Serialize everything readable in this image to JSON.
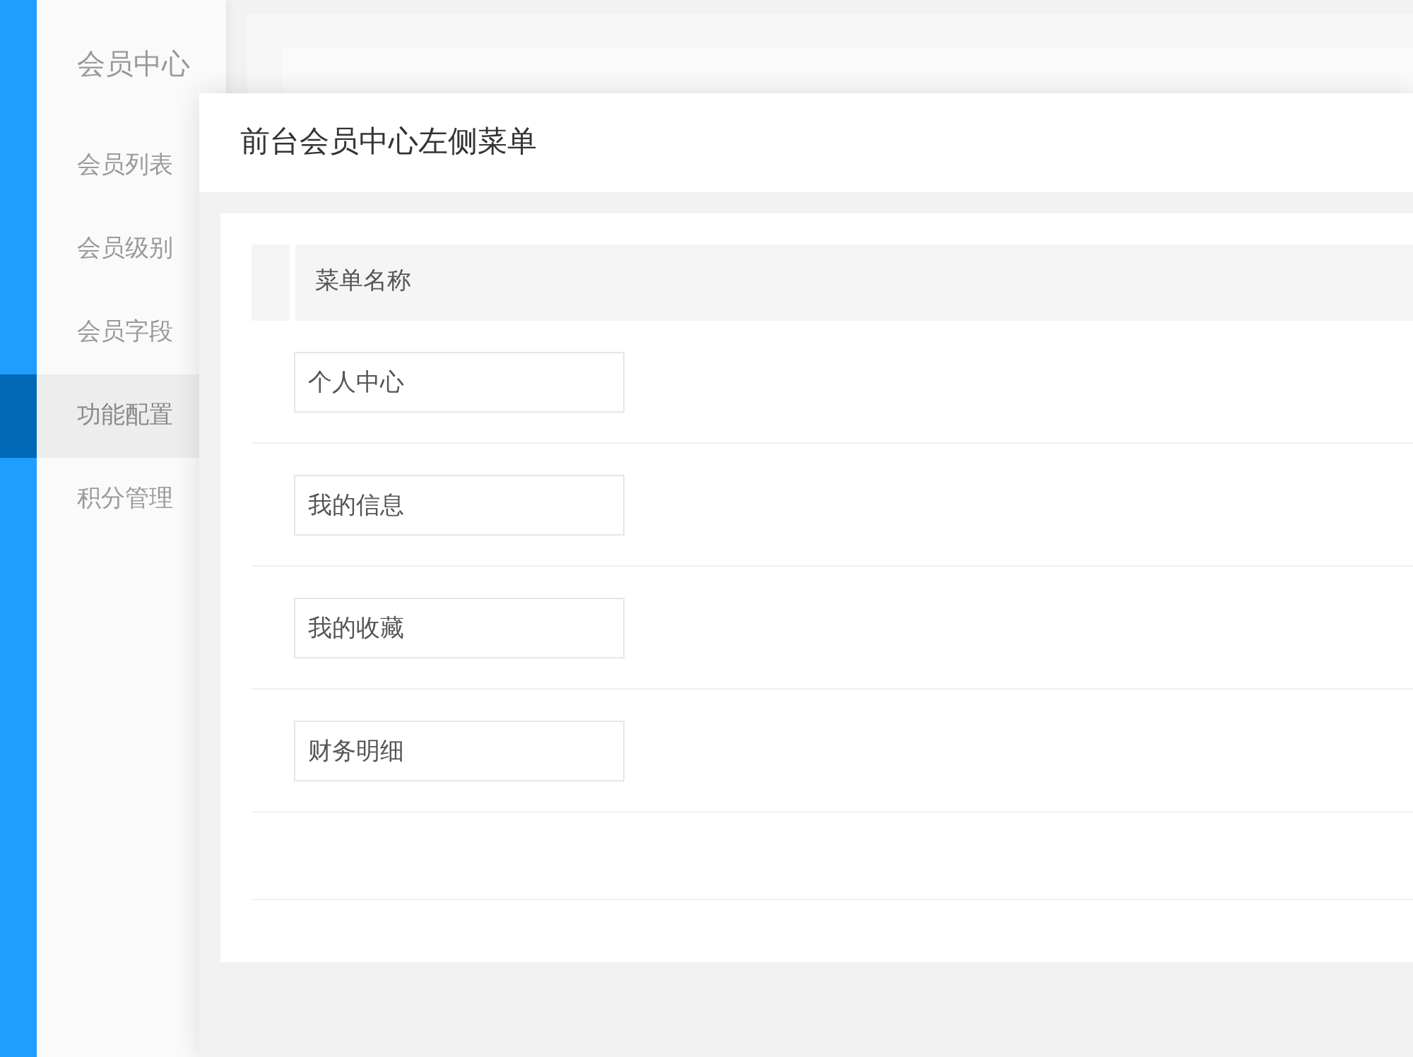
{
  "sidebar": {
    "title": "会员中心",
    "items": [
      {
        "label": "会员列表",
        "selected": false
      },
      {
        "label": "会员级别",
        "selected": false
      },
      {
        "label": "会员字段",
        "selected": false
      },
      {
        "label": "功能配置",
        "selected": true
      },
      {
        "label": "积分管理",
        "selected": false
      }
    ]
  },
  "modal": {
    "title": "前台会员中心左侧菜单",
    "table": {
      "columns": [
        "菜单名称"
      ],
      "rows": [
        {
          "value": "个人中心"
        },
        {
          "value": "我的信息"
        },
        {
          "value": "我的收藏"
        },
        {
          "value": "财务明细"
        }
      ]
    }
  }
}
